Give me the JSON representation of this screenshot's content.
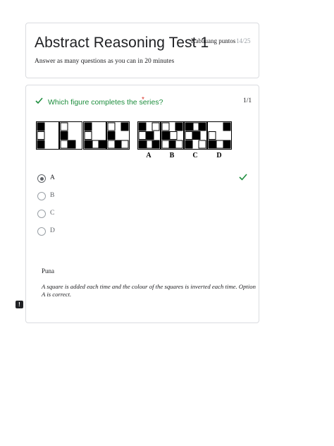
{
  "header": {
    "title": "Abstract Reasoning Test 1",
    "score_label": "Kabuuang puntos",
    "score_value": "14/25",
    "description": "Answer as many questions as you can in 20 minutes"
  },
  "question": {
    "title": "Which figure completes the series?",
    "required_mark": "*",
    "points": "1/1",
    "answer_labels": [
      "A",
      "B",
      "C",
      "D"
    ],
    "options": [
      {
        "label": "A",
        "selected": true,
        "correct": true
      },
      {
        "label": "B",
        "selected": false
      },
      {
        "label": "C",
        "selected": false
      },
      {
        "label": "D",
        "selected": false
      }
    ]
  },
  "feedback": {
    "title": "Puna",
    "text": "A square is added each time and the colour of the squares is inverted each time. Option A is correct."
  },
  "icons": {
    "status": "check-icon",
    "correct": "check-icon",
    "report": "report-problem-icon"
  },
  "colors": {
    "correct_green": "#1e8e3e",
    "required_red": "#d93025"
  }
}
